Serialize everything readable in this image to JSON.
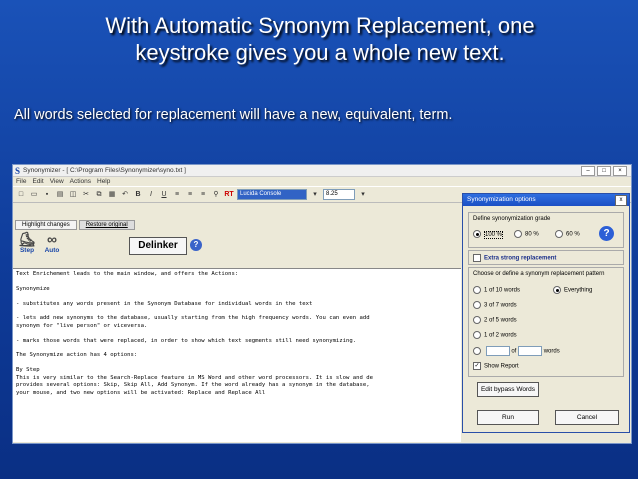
{
  "slide": {
    "title_line1": "With Automatic Synonym Replacement, one",
    "title_line2": "keystroke gives you a whole new text.",
    "subtitle": "All words selected for replacement will have a new, equivalent, term."
  },
  "app": {
    "icon": "S",
    "title": "Synonymizer - [ C:\\Program Files\\Synonymizer\\syno.txt ]",
    "menu": [
      "File",
      "Edit",
      "View",
      "Actions",
      "Help"
    ],
    "toolbar": {
      "bold": "B",
      "italic": "I",
      "underline": "U",
      "rt": "RT",
      "font": "Lucida Console",
      "size": "8.25"
    },
    "tabs": [
      "Highlight changes",
      "Restore original"
    ],
    "step_label": "Step",
    "auto_label": "Auto",
    "delinker_label": "Delinker",
    "help_icon": "?",
    "editor_lines": [
      "Text Enrichement leads to the main window, and offers the Actions:",
      "",
      "Synonymize",
      "",
      "- substitutes any words present in the Synonym Database for individual words in the text",
      "",
      "- lets add new synonyms to the database, usually starting from the high frequency words. You can even add",
      "synonym for \"live person\" or viceversa.",
      "",
      "- marks those words that were replaced, in order to show which text segments still need synonymizing.",
      "",
      "The Synonymize action has 4 options:",
      "",
      "By Step",
      "This is very similar to the Search-Replace feature in MS Word and other word processors. It is slow and de",
      "provides several options: Skip, Skip All, Add Synonym. If the word already has a synonym in the database,",
      "your mouse, and two new options will be activated: Replace and Replace All"
    ]
  },
  "dialog": {
    "title": "Synonymization options",
    "close": "x",
    "grade_label": "Define synonymization grade",
    "grades": [
      "100 %",
      "80 %",
      "60 %"
    ],
    "grade_selected": "100 %",
    "extra_strong": "Extra strong replacement",
    "pattern_label": "Choose or define a synonym replacement pattern",
    "patterns": [
      "1 of 10 words",
      "Everything",
      "3 of 7 words",
      "2 of 5 words",
      "1 of 2 words"
    ],
    "pattern_selected": "Everything",
    "custom_of": "of",
    "custom_words": "words",
    "show_report": "Show Report",
    "edit_bypass": "Edit bypass Words",
    "run": "Run",
    "cancel": "Cancel"
  }
}
